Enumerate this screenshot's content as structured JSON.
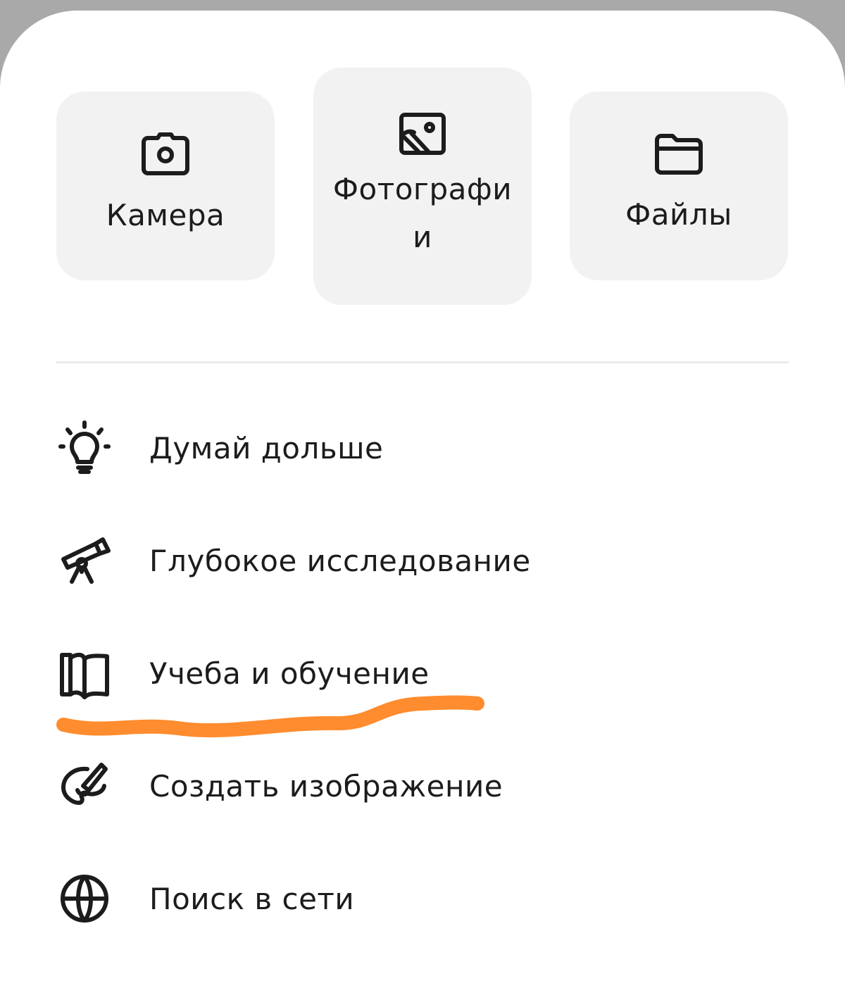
{
  "attachments": [
    {
      "icon": "camera-icon",
      "label": "Камера"
    },
    {
      "icon": "image-icon",
      "label": "Фотографи и"
    },
    {
      "icon": "folder-icon",
      "label": "Файлы"
    }
  ],
  "menu": {
    "items": [
      {
        "icon": "lightbulb-icon",
        "label": "Думай дольше"
      },
      {
        "icon": "telescope-icon",
        "label": "Глубокое исследование"
      },
      {
        "icon": "book-icon",
        "label": "Учеба и обучение"
      },
      {
        "icon": "palette-icon",
        "label": "Создать изображение"
      },
      {
        "icon": "globe-icon",
        "label": "Поиск в сети"
      }
    ]
  },
  "colors": {
    "sheet_background": "#ffffff",
    "tile_background": "#f2f2f2",
    "text": "#1c1c1c",
    "annotation_stroke": "#ff8c2e",
    "backdrop": "#a9a9a9"
  }
}
